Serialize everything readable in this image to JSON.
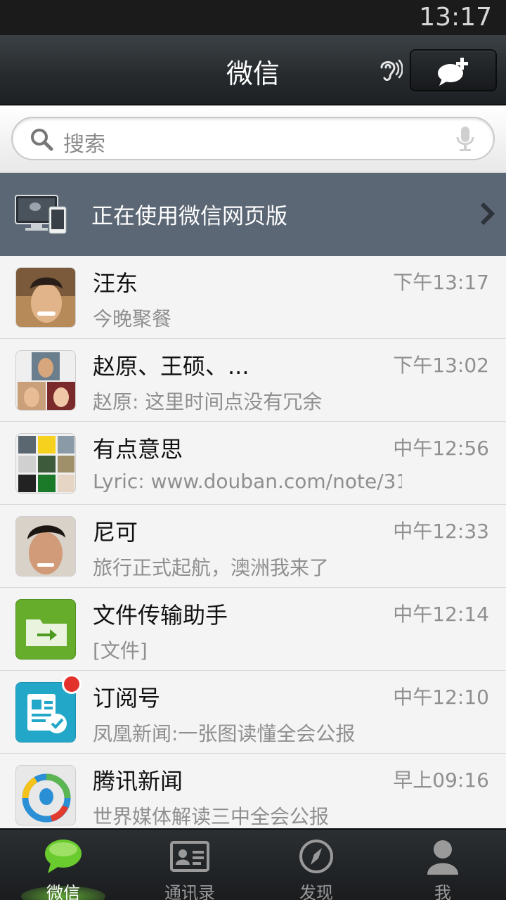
{
  "status_bar": {
    "time": "13:17"
  },
  "header": {
    "title": "微信",
    "icons": [
      "earpiece-icon",
      "add-chat-icon"
    ]
  },
  "search": {
    "placeholder": "搜索"
  },
  "web_banner": {
    "label": "正在使用微信网页版"
  },
  "chats": [
    {
      "name": "汪东",
      "time": "下午13:17",
      "preview": "今晚聚餐"
    },
    {
      "name": "赵原、王硕、...",
      "time": "下午13:02",
      "preview": "赵原: 这里时间点没有冗余"
    },
    {
      "name": "有点意思",
      "time": "中午12:56",
      "preview": "Lyric: www.douban.com/note/31..."
    },
    {
      "name": "尼可",
      "time": "中午12:33",
      "preview": "旅行正式起航，澳洲我来了"
    },
    {
      "name": "文件传输助手",
      "time": "中午12:14",
      "preview": "[文件]"
    },
    {
      "name": "订阅号",
      "time": "中午12:10",
      "preview": "凤凰新闻:一张图读懂全会公报"
    },
    {
      "name": "腾讯新闻",
      "time": "早上09:16",
      "preview": "世界媒体解读三中全会公报"
    }
  ],
  "tabs": [
    {
      "label": "微信",
      "icon": "chat-bubble-icon",
      "active": true
    },
    {
      "label": "通讯录",
      "icon": "contacts-card-icon",
      "active": false
    },
    {
      "label": "发现",
      "icon": "compass-icon",
      "active": false
    },
    {
      "label": "我",
      "icon": "person-icon",
      "active": false
    }
  ],
  "colors": {
    "banner": "#5c6776",
    "accent_green": "#5fbe2a",
    "badge_red": "#e3312c"
  }
}
